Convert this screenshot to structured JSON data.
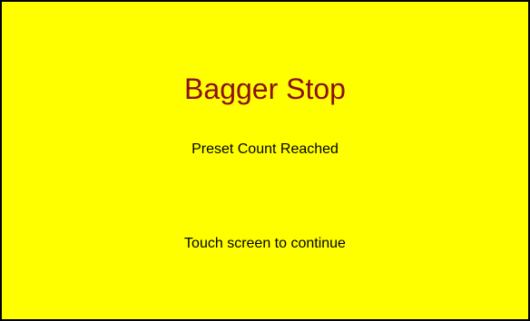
{
  "alert": {
    "title": "Bagger Stop",
    "message": "Preset Count Reached",
    "prompt": "Touch screen to continue"
  },
  "colors": {
    "background": "#ffff00",
    "title": "#8b1010",
    "text": "#000000",
    "border": "#000000"
  }
}
